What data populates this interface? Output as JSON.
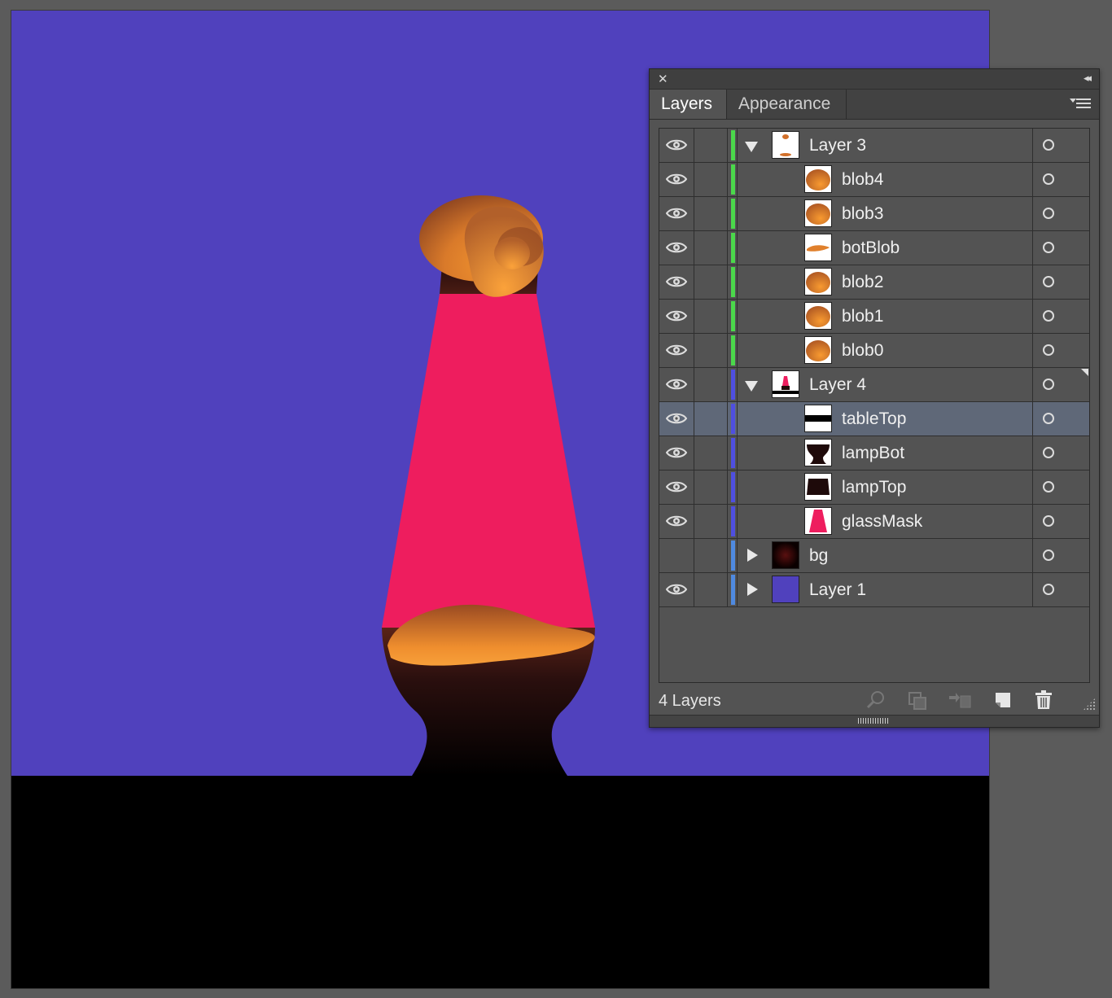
{
  "panel": {
    "tabs": [
      {
        "label": "Layers",
        "active": true
      },
      {
        "label": "Appearance",
        "active": false
      }
    ],
    "footer": {
      "layer_count": "4 Layers"
    }
  },
  "layers": [
    {
      "name": "Layer 3",
      "level": 0,
      "expanded": true,
      "visible": true,
      "color": "#4bd84b",
      "thumb": "layer3-thumb"
    },
    {
      "name": "blob4",
      "level": 1,
      "visible": true,
      "color": "#4bd84b",
      "thumb": "blob-thumb"
    },
    {
      "name": "blob3",
      "level": 1,
      "visible": true,
      "color": "#4bd84b",
      "thumb": "blob-thumb"
    },
    {
      "name": "botBlob",
      "level": 1,
      "visible": true,
      "color": "#4bd84b",
      "thumb": "botblob-thumb"
    },
    {
      "name": "blob2",
      "level": 1,
      "visible": true,
      "color": "#4bd84b",
      "thumb": "blob-thumb"
    },
    {
      "name": "blob1",
      "level": 1,
      "visible": true,
      "color": "#4bd84b",
      "thumb": "blob-thumb"
    },
    {
      "name": "blob0",
      "level": 1,
      "visible": true,
      "color": "#4bd84b",
      "thumb": "blob-thumb"
    },
    {
      "name": "Layer 4",
      "level": 0,
      "expanded": true,
      "visible": true,
      "color": "#4f4fe0",
      "thumb": "layer4-thumb",
      "target_mark": true
    },
    {
      "name": "tableTop",
      "level": 1,
      "visible": true,
      "color": "#4f4fe0",
      "thumb": "tabletop-thumb",
      "selected": true
    },
    {
      "name": "lampBot",
      "level": 1,
      "visible": true,
      "color": "#4f4fe0",
      "thumb": "lampbot-thumb"
    },
    {
      "name": "lampTop",
      "level": 1,
      "visible": true,
      "color": "#4f4fe0",
      "thumb": "lamptop-thumb"
    },
    {
      "name": "glassMask",
      "level": 1,
      "visible": true,
      "color": "#4f4fe0",
      "thumb": "glassmask-thumb"
    },
    {
      "name": "bg",
      "level": 0,
      "expanded": false,
      "visible": false,
      "color": "#4f8ae0",
      "thumb": "bg-thumb"
    },
    {
      "name": "Layer 1",
      "level": 0,
      "expanded": false,
      "visible": true,
      "color": "#4f8ae0",
      "thumb": "layer1-thumb"
    }
  ],
  "colors": {
    "artboard_bg": "#5041bd",
    "table": "#000000",
    "glass": "#ee1d5e",
    "wax_light": "#f7982e",
    "wax_dark": "#9a4a1e",
    "lamp_base": "#1a0a0a"
  }
}
